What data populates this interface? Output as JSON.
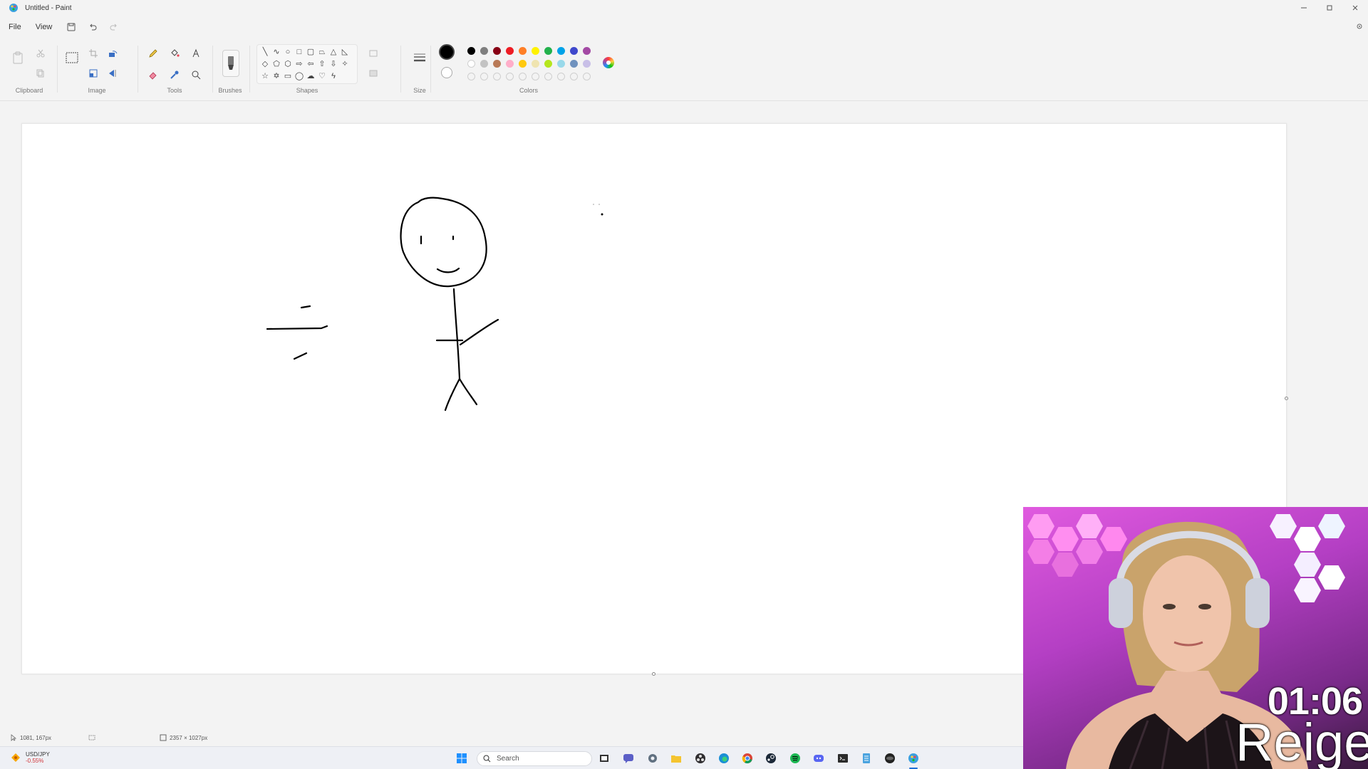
{
  "window": {
    "title": "Untitled - Paint",
    "controls": [
      "minimize-icon",
      "restore-icon",
      "close-icon"
    ]
  },
  "menu": {
    "file": "File",
    "view": "View"
  },
  "ribbon": {
    "groups": {
      "clipboard": "Clipboard",
      "image": "Image",
      "tools": "Tools",
      "brushes": "Brushes",
      "shapes": "Shapes",
      "size": "Size",
      "colors": "Colors"
    },
    "primary_color": "#000000",
    "secondary_color": "#ffffff",
    "palette_row1": [
      "#000000",
      "#7f7f7f",
      "#880015",
      "#ed1c24",
      "#ff7f27",
      "#fff200",
      "#22b14c",
      "#00a2e8",
      "#3f48cc",
      "#a349a4"
    ],
    "palette_row2": [
      "#ffffff",
      "#c3c3c3",
      "#b97a57",
      "#ffaec9",
      "#ffc90e",
      "#efe4b0",
      "#b5e61d",
      "#99d9ea",
      "#7092be",
      "#c8bfe7"
    ]
  },
  "status": {
    "cursor_position": "1081, 167px",
    "canvas_size": "2357 × 1027px"
  },
  "taskbar": {
    "search_placeholder": "Search",
    "ticker_name": "USD/JPY",
    "ticker_change": "-0.55%"
  },
  "webcam": {
    "timer": "01:06",
    "name": "Reige"
  }
}
